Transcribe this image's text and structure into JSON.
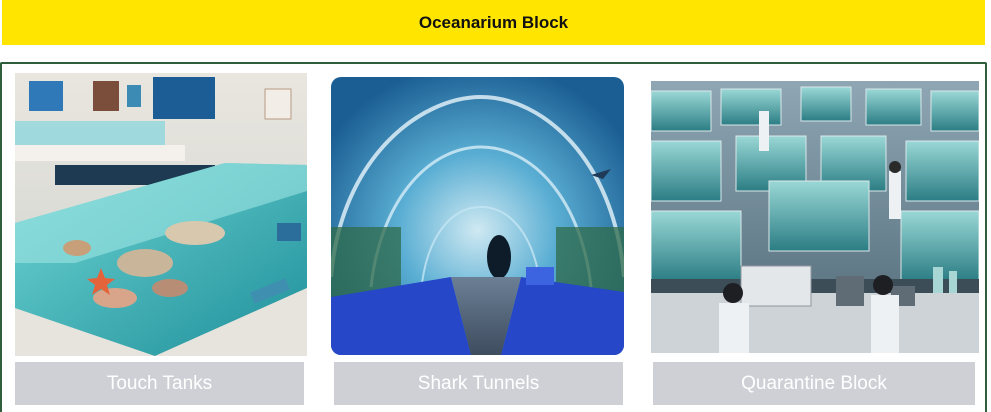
{
  "banner": {
    "title": "Oceanarium Block"
  },
  "colors": {
    "banner_background": "#ffe500",
    "panel_border": "#2f5e3c",
    "caption_background": "#cfcfd6",
    "caption_text": "#ffffff"
  },
  "cards": [
    {
      "label": "Touch Tanks"
    },
    {
      "label": "Shark Tunnels"
    },
    {
      "label": "Quarantine Block"
    }
  ]
}
